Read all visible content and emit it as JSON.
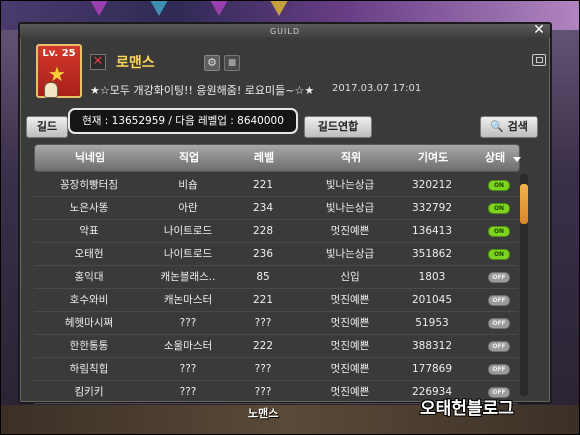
{
  "window": {
    "title": "GUILD",
    "close_glyph": "✕"
  },
  "guild": {
    "level_badge": "Lv. 25",
    "name": "로맨스",
    "emblem_icon": "crossed-swords-icon",
    "notice": "★☆모두 개강화이팅!! 응원해줌! 로요미들~☆★",
    "notice_date": "2017.03.07 17:01",
    "exp_text": "현재 : 13652959 / 다음 레벨업 : 8640000"
  },
  "tabs": {
    "guild": "길드",
    "union": "길드연합",
    "search": "검색"
  },
  "table": {
    "headers": [
      "닉네임",
      "직업",
      "레벨",
      "직위",
      "기여도",
      "상태"
    ],
    "rows": [
      {
        "name": "꽁장히빵터짐",
        "job": "비숍",
        "level": "221",
        "rank": "빛나는상급",
        "contrib": "320212",
        "status": "on"
      },
      {
        "name": "노은사똥",
        "job": "아란",
        "level": "234",
        "rank": "빛나는상급",
        "contrib": "332792",
        "status": "on"
      },
      {
        "name": "악표",
        "job": "나이트로드",
        "level": "228",
        "rank": "멋진예쁜",
        "contrib": "136413",
        "status": "on"
      },
      {
        "name": "오태헌",
        "job": "나이트로드",
        "level": "236",
        "rank": "빛나는상급",
        "contrib": "351862",
        "status": "on"
      },
      {
        "name": "홍익대",
        "job": "캐논블래스..",
        "level": "85",
        "rank": "신입",
        "contrib": "1803",
        "status": "off"
      },
      {
        "name": "호수와비",
        "job": "캐논마스터",
        "level": "221",
        "rank": "멋진예쁜",
        "contrib": "201045",
        "status": "off"
      },
      {
        "name": "헤헷마시쪄",
        "job": "???",
        "level": "???",
        "rank": "멋진예쁜",
        "contrib": "51953",
        "status": "off"
      },
      {
        "name": "한한통통",
        "job": "소울마스터",
        "level": "222",
        "rank": "멋진예쁜",
        "contrib": "388312",
        "status": "off"
      },
      {
        "name": "하림칙힙",
        "job": "???",
        "level": "???",
        "rank": "멋진예쁜",
        "contrib": "177869",
        "status": "off"
      },
      {
        "name": "킴키키",
        "job": "???",
        "level": "???",
        "rank": "멋진예쁜",
        "contrib": "226934",
        "status": "off"
      }
    ]
  },
  "toggle_labels": {
    "on": "ON",
    "off": "OFF"
  },
  "bottom_label": "노맨스",
  "watermark": "오태헌블로그",
  "colors": {
    "guild_name": "#ffd55a",
    "status_on": "#7ed321",
    "status_off": "#9b9b9b",
    "scroll_thumb": "#e59a35"
  }
}
